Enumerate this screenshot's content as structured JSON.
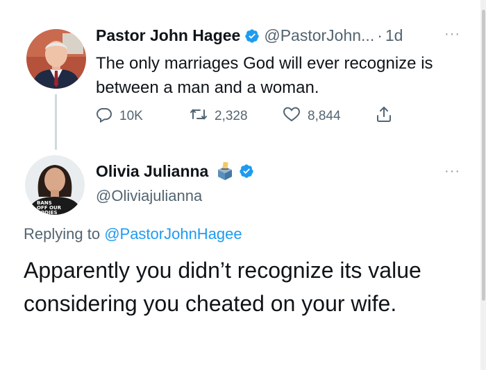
{
  "parent_tweet": {
    "author_name": "Pastor John Hagee",
    "handle": "@PastorJohn...",
    "separator": "·",
    "time": "1d",
    "text": "The only marriages God will ever recognize is between a man and a woman.",
    "more": "···",
    "stats": {
      "replies": "10K",
      "retweets": "2,328",
      "likes": "8,844"
    },
    "icons": {
      "verified": "verified-badge-icon",
      "reply": "comment-icon",
      "retweet": "retweet-icon",
      "like": "heart-icon",
      "share": "share-icon"
    }
  },
  "reply_tweet": {
    "author_name": "Olivia Julianna",
    "handle": "@Oliviajulianna",
    "more": "···",
    "replying_prefix": "Replying to ",
    "replying_to": "@PastorJohnHagee",
    "text": "Apparently you didn’t recognize its value considering you cheated on your wife.",
    "avatar_shirt_text": "BANS OFF OUR BODIES",
    "icons": {
      "emoji": "ballot-box-emoji-icon",
      "verified": "verified-badge-icon"
    }
  },
  "colors": {
    "text": "#0f1419",
    "secondary": "#536471",
    "link": "#1d9bf0",
    "verified": "#1d9bf0",
    "thread_line": "#cfd9de"
  }
}
